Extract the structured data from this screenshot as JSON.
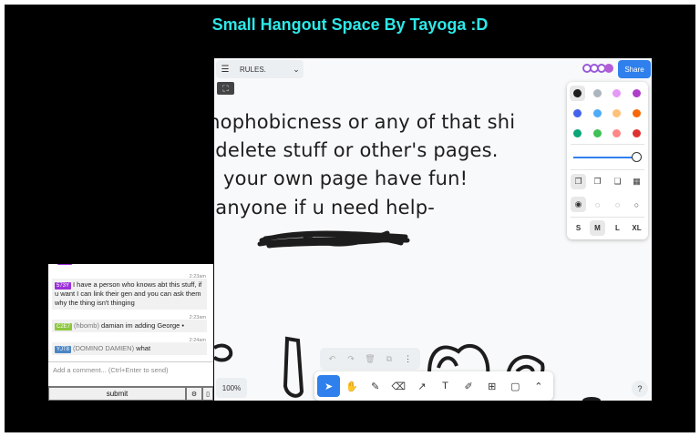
{
  "page": {
    "title": "Small Hangout Space By Tayoga :D"
  },
  "board": {
    "page_menu": {
      "label": "RULES."
    },
    "share_label": "Share",
    "zoom_label": "100%",
    "help_label": "?",
    "rules": [
      "mophobicness or any of that shi",
      "t delete stuff or other's pages.",
      "your own page have fun!",
      "t anyone if u need help-"
    ],
    "style_panel": {
      "colors": [
        "#1d1d1d",
        "#adb5bd",
        "#e599f7",
        "#ae3ec9",
        "#4263eb",
        "#4dabf7",
        "#ffc078",
        "#f76707",
        "#0ca678",
        "#40c057",
        "#ff8787",
        "#e03131"
      ],
      "sizes": [
        "S",
        "M",
        "L",
        "XL"
      ],
      "selected_size": "M"
    },
    "tools": [
      "select-icon",
      "hand-icon",
      "pencil-icon",
      "eraser-icon",
      "arrow-icon",
      "text-icon",
      "note-icon",
      "image-icon",
      "rectangle-icon",
      "chevron-up-icon"
    ]
  },
  "chat": {
    "messages": [
      {
        "time": "2:23am",
        "tag": "573Y",
        "tag_color": "#9b30d9",
        "handle": "",
        "text": "I have a person who knows abt this stuff, if u want I can link their gen and you can ask them why the thing isn't thinging"
      },
      {
        "time": "2:23am",
        "tag": "C2E7",
        "tag_color": "#8dc63f",
        "handle": "(hbomb)",
        "text": "damian im adding George •"
      },
      {
        "time": "2:24am",
        "tag": "YJT8",
        "tag_color": "#4a86c5",
        "handle": "(DOMINO DAMIEN)",
        "text": "what"
      }
    ],
    "input_placeholder": "Add a comment... (Ctrl+Enter to send)",
    "submit_label": "submit"
  }
}
